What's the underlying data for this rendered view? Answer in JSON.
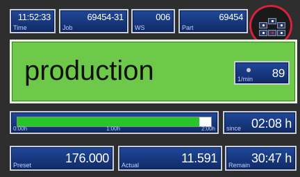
{
  "header": {
    "time": {
      "value": "11:52:33",
      "label": "Time"
    },
    "job": {
      "value": "69454-31",
      "label": "Job"
    },
    "ws": {
      "value": "006",
      "label": "WS"
    },
    "part": {
      "value": "69454",
      "label": "Part"
    }
  },
  "status": {
    "text": "production",
    "color": "#6ec94a",
    "rate": {
      "value": "89",
      "label": "1/min"
    }
  },
  "timeline": {
    "ticks": [
      "0:00h",
      "1:00h",
      "2:00h"
    ],
    "progress_fraction": 0.94,
    "bar_color": "#27c42a",
    "since": {
      "value": "02:08 h",
      "label": "since"
    }
  },
  "counters": {
    "preset": {
      "value": "176.000",
      "label": "Preset"
    },
    "actual": {
      "value": "11.591",
      "label": "Actual"
    },
    "remain": {
      "value": "30:47 h",
      "label": "Remain"
    }
  },
  "status_indicator": {
    "border_color": "#d8213a",
    "icons": [
      "cell-icon",
      "cell-icon",
      "cell-icon",
      "cell-icon",
      "alarm-icon",
      "cell-icon"
    ]
  }
}
